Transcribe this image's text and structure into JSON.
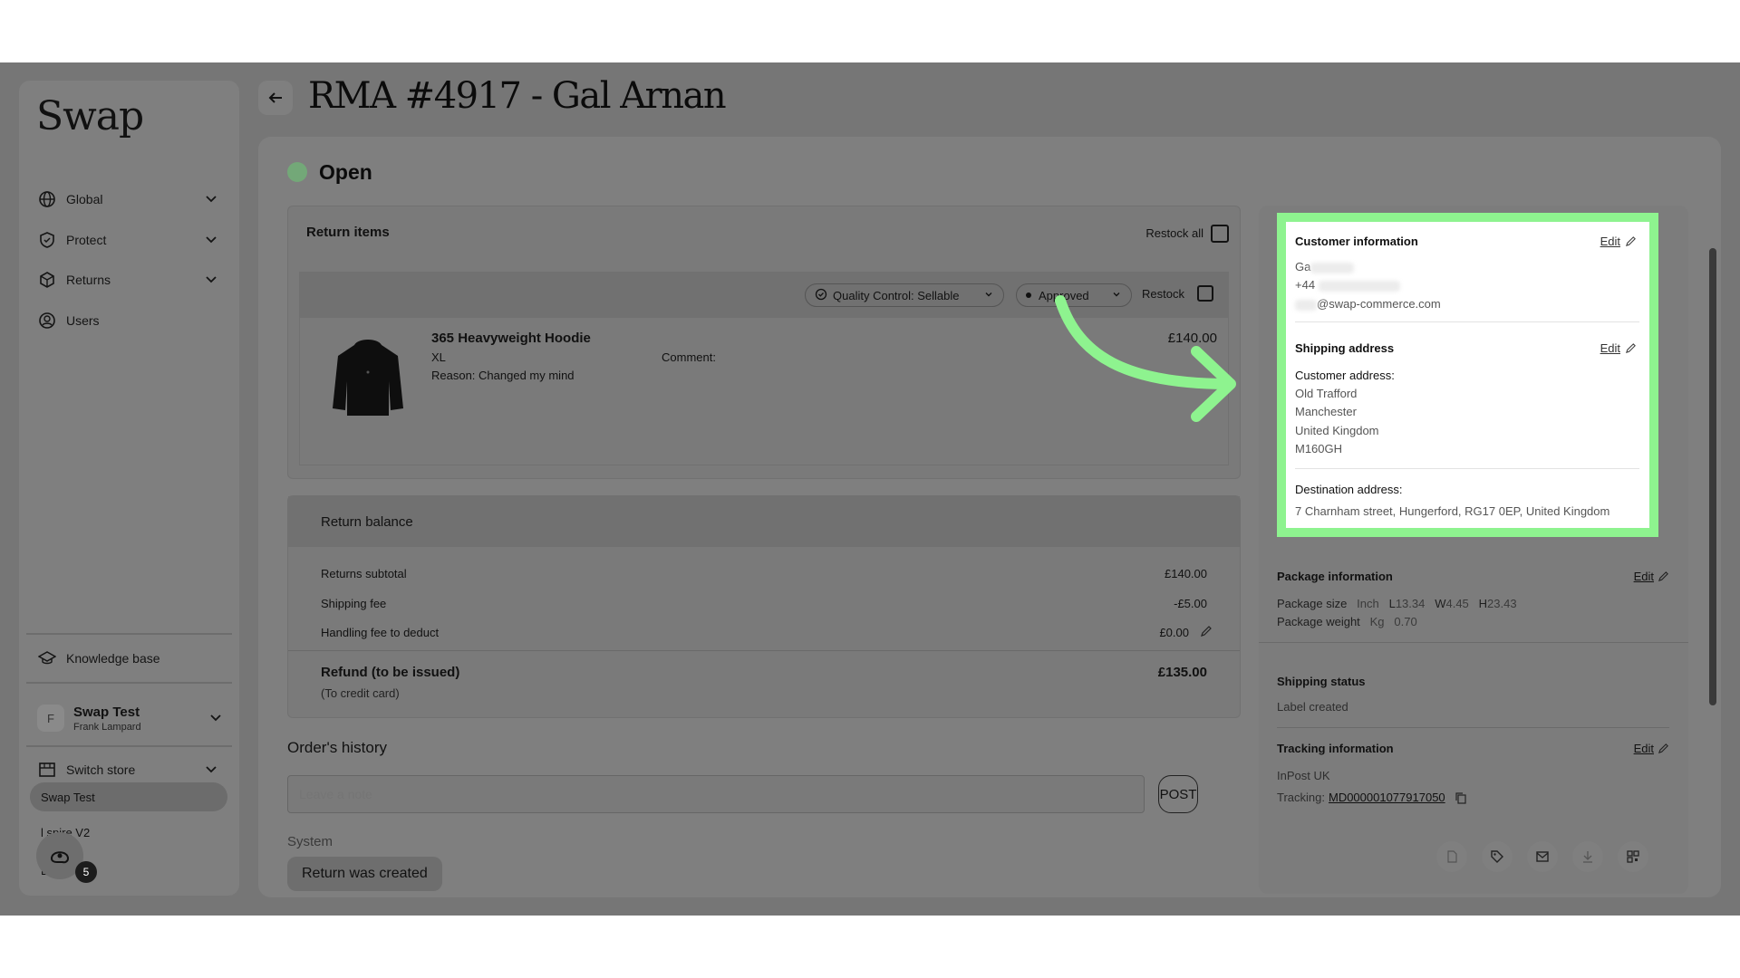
{
  "sidebar": {
    "logo": "Swap",
    "nav": [
      {
        "label": "Global",
        "icon": "globe-icon"
      },
      {
        "label": "Protect",
        "icon": "shield-icon"
      },
      {
        "label": "Returns",
        "icon": "box-icon"
      },
      {
        "label": "Users",
        "icon": "user-icon"
      }
    ],
    "knowledge_base": "Knowledge base",
    "account": {
      "avatar": "F",
      "name": "Swap Test",
      "sub": "Frank Lampard"
    },
    "switch_store": "Switch store",
    "stores": [
      "Swap Test",
      "l     spire V2",
      "L     ut"
    ],
    "badge_count": "5"
  },
  "header": {
    "title": "RMA #4917 - Gal Arnan"
  },
  "status": {
    "label": "Open",
    "color": "#73a878"
  },
  "return_items": {
    "title": "Return items",
    "restock_all": "Restock all",
    "qc_label": "Quality Control: Sellable",
    "approved_label": "Approved",
    "restock": "Restock",
    "item": {
      "name": "365 Heavyweight Hoodie",
      "size": "XL",
      "reason": "Reason: Changed my mind",
      "comment": "Comment:",
      "price": "£140.00"
    }
  },
  "balance": {
    "title": "Return balance",
    "rows": [
      {
        "label": "Returns subtotal",
        "value": "£140.00"
      },
      {
        "label": "Shipping fee",
        "value": "-£5.00"
      },
      {
        "label": "Handling fee to deduct",
        "value": "£0.00"
      }
    ],
    "refund_label": "Refund (to be issued)",
    "refund_sub": "(To credit card)",
    "refund_value": "£135.00"
  },
  "history": {
    "title": "Order's history",
    "note_placeholder": "Leave a note",
    "post": "POST",
    "system": "System",
    "event": "Return was created"
  },
  "customer": {
    "title": "Customer information",
    "edit": "Edit",
    "name_prefix": "Ga",
    "phone_prefix": "+44",
    "email_suffix": "@swap-commerce.com"
  },
  "shipping": {
    "title": "Shipping address",
    "edit": "Edit",
    "customer_label": "Customer address:",
    "lines": [
      "Old Trafford",
      "Manchester",
      "United Kingdom",
      "M160GH"
    ],
    "destination_label": "Destination address:",
    "destination": "7 Charnham street, Hungerford, RG17 0EP, United Kingdom"
  },
  "package": {
    "title": "Package information",
    "edit": "Edit",
    "size_label": "Package size",
    "size_unit": "Inch",
    "l": "13.34",
    "w": "4.45",
    "h": "23.43",
    "weight_label": "Package weight",
    "weight_unit": "Kg",
    "weight": "0.70"
  },
  "shipping_status": {
    "title": "Shipping status",
    "value": "Label created"
  },
  "tracking": {
    "title": "Tracking information",
    "edit": "Edit",
    "carrier": "InPost UK",
    "label": "Tracking:",
    "number": "MD000001077917050"
  },
  "colors": {
    "highlight": "#8ef38f",
    "accent": "#73a878"
  }
}
